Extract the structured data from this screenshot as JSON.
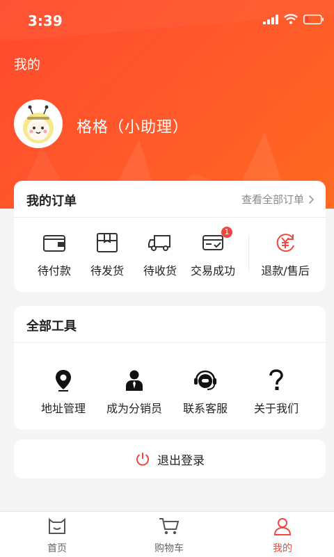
{
  "status_bar": {
    "time": "3:39"
  },
  "header": {
    "title": "我的",
    "username": "格格（小助理）"
  },
  "orders": {
    "title": "我的订单",
    "view_all": "查看全部订单",
    "items": [
      {
        "label": "待付款",
        "icon": "wallet-icon"
      },
      {
        "label": "待发货",
        "icon": "package-icon"
      },
      {
        "label": "待收货",
        "icon": "truck-icon"
      },
      {
        "label": "交易成功",
        "icon": "card-check-icon",
        "badge": "1"
      },
      {
        "label": "退款/售后",
        "icon": "refund-yen-icon"
      }
    ]
  },
  "tools": {
    "title": "全部工具",
    "items": [
      {
        "label": "地址管理",
        "icon": "location-pin-icon"
      },
      {
        "label": "成为分销员",
        "icon": "businessman-icon"
      },
      {
        "label": "联系客服",
        "icon": "headset-icon"
      },
      {
        "label": "关于我们",
        "icon": "question-mark-icon"
      }
    ]
  },
  "logout": {
    "label": "退出登录"
  },
  "tabbar": {
    "items": [
      {
        "label": "首页",
        "icon": "home-icon",
        "active": false
      },
      {
        "label": "购物车",
        "icon": "cart-icon",
        "active": false
      },
      {
        "label": "我的",
        "icon": "profile-icon",
        "active": true
      }
    ]
  },
  "colors": {
    "accent": "#f0463c",
    "header_start": "#ff4a2e",
    "header_end": "#ff6a1f"
  }
}
